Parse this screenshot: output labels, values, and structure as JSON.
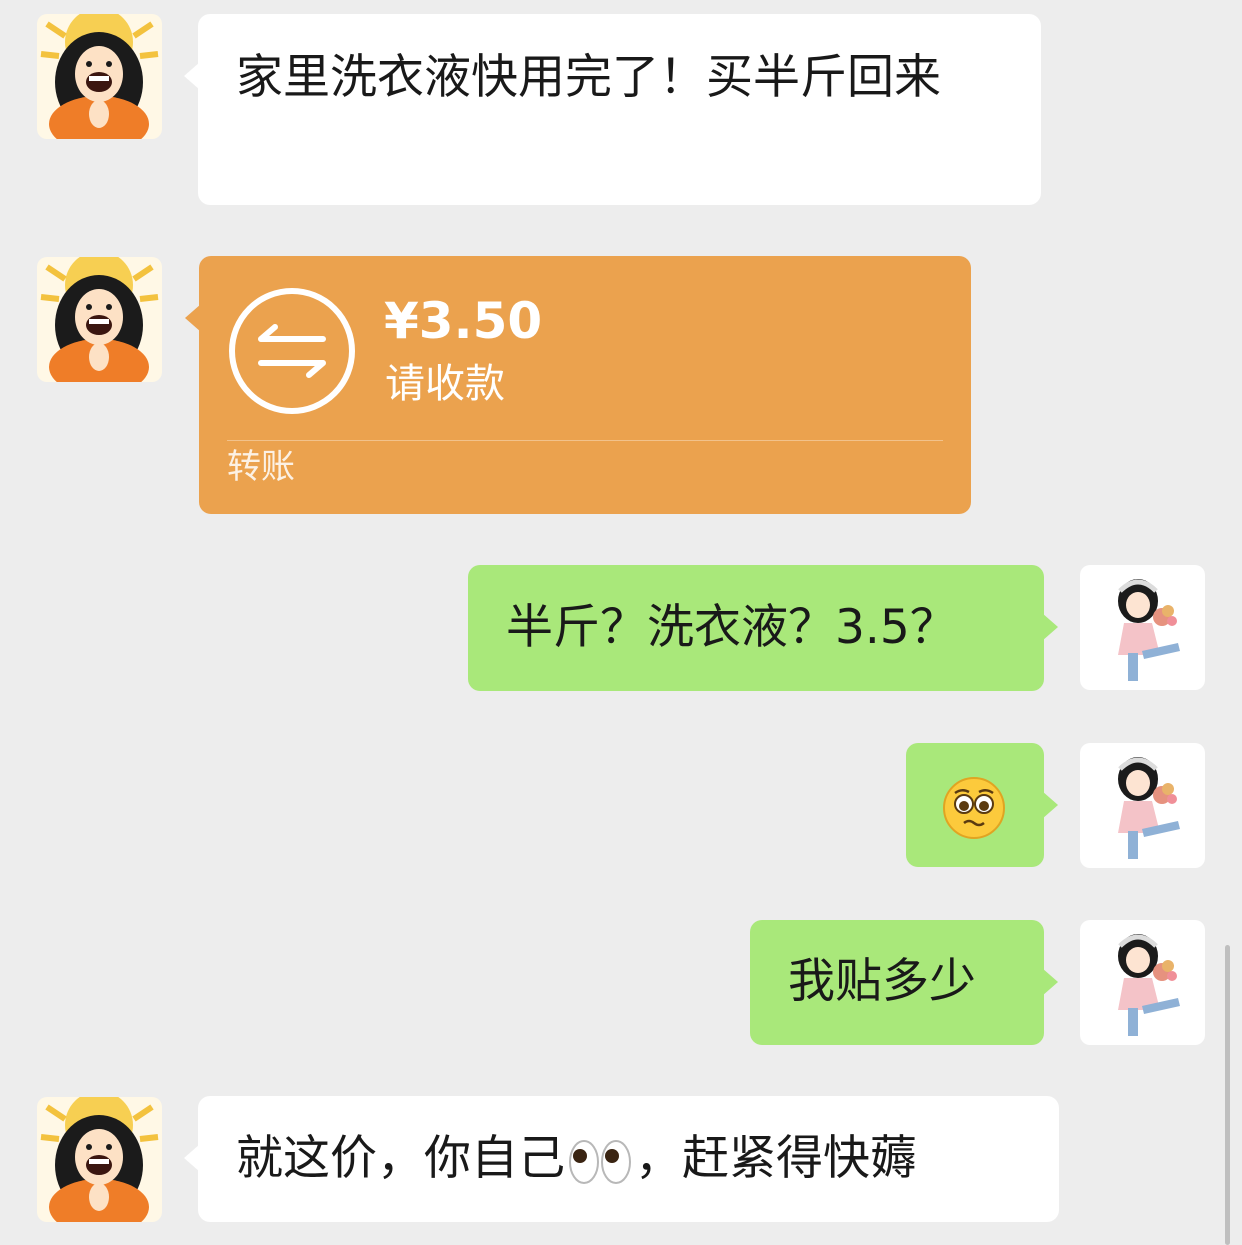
{
  "chat": {
    "messages": [
      {
        "side": "left",
        "kind": "text",
        "text": "家里洗衣液快用完了！买半斤回来"
      },
      {
        "side": "left",
        "kind": "transfer",
        "amount": "¥3.50",
        "status": "请收款",
        "label": "转账"
      },
      {
        "side": "right",
        "kind": "text",
        "text": "半斤？洗衣液？3.5？"
      },
      {
        "side": "right",
        "kind": "emoji",
        "emoji": "pleading-face-emoji"
      },
      {
        "side": "right",
        "kind": "text",
        "text": "我贴多少"
      },
      {
        "side": "left",
        "kind": "text",
        "text_before": "就这价，你自己",
        "emoji": "eyes-emoji",
        "text_after": "，赶紧得快薅"
      }
    ]
  },
  "colors": {
    "background": "#ededed",
    "incoming_bubble": "#ffffff",
    "outgoing_bubble": "#a9e87a",
    "transfer_card": "#eba24e"
  }
}
